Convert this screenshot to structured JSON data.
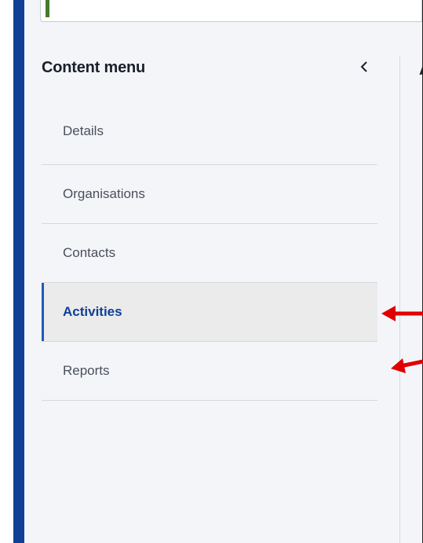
{
  "content_menu": {
    "title": "Content menu",
    "collapse_icon": "chevron-left-icon",
    "items": [
      {
        "label": "Details",
        "active": false
      },
      {
        "label": "Organisations",
        "active": false
      },
      {
        "label": "Contacts",
        "active": false
      },
      {
        "label": "Activities",
        "active": true
      },
      {
        "label": "Reports",
        "active": false
      }
    ]
  },
  "main": {
    "title_fragment": "A"
  },
  "annotations": {
    "color": "#e00000",
    "arrows": [
      "arrow-to-activities",
      "arrow-to-reports"
    ]
  },
  "colors": {
    "sidebar_stripe": "#0f3f96",
    "active_text": "#0e3e97",
    "active_indicator": "#1f5ab8",
    "top_card_accent": "#467a2d",
    "page_background": "#f4f5f9"
  }
}
